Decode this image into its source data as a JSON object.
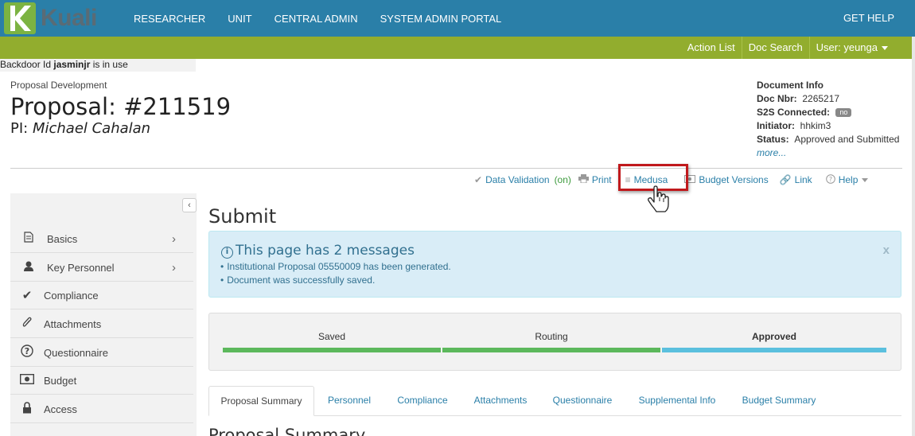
{
  "app": {
    "logo_text": "Kuali"
  },
  "topnav": [
    "RESEARCHER",
    "UNIT",
    "CENTRAL ADMIN",
    "SYSTEM ADMIN PORTAL"
  ],
  "get_help": "GET HELP",
  "greenbar": {
    "action_list": "Action List",
    "doc_search": "Doc Search",
    "user": "User: yeunga"
  },
  "backdoor": {
    "prefix": "Backdoor Id ",
    "user": "jasminjr",
    "suffix": " is in use"
  },
  "header": {
    "crumb": "Proposal Development",
    "title": "Proposal: #211519",
    "pi_label": "PI: ",
    "pi_name": "Michael Cahalan"
  },
  "docinfo": {
    "heading": "Document Info",
    "doc_nbr_label": "Doc Nbr:",
    "doc_nbr": "2265217",
    "s2s_label": "S2S Connected:",
    "s2s_value": "no",
    "initiator_label": "Initiator:",
    "initiator": "hhkim3",
    "status_label": "Status:",
    "status": "Approved and Submitted",
    "more": "more..."
  },
  "toolbar": {
    "data_validation": "Data Validation",
    "on": "(on)",
    "print": "Print",
    "medusa": "Medusa",
    "budget_versions": "Budget Versions",
    "link": "Link",
    "help": "Help"
  },
  "sidebar": {
    "items": [
      {
        "label": "Basics",
        "icon": "document-icon"
      },
      {
        "label": "Key Personnel",
        "icon": "person-icon"
      },
      {
        "label": "Compliance",
        "icon": "check-icon"
      },
      {
        "label": "Attachments",
        "icon": "paperclip-icon"
      },
      {
        "label": "Questionnaire",
        "icon": "question-icon"
      },
      {
        "label": "Budget",
        "icon": "money-icon"
      },
      {
        "label": "Access",
        "icon": "lock-icon"
      }
    ]
  },
  "main": {
    "heading": "Submit",
    "alert": {
      "title": "This page has 2 messages",
      "messages": [
        "Institutional Proposal 05550009 has been generated.",
        "Document was successfully saved."
      ],
      "close": "x"
    },
    "progress": [
      {
        "label": "Saved",
        "color": "#5cb85c"
      },
      {
        "label": "Routing",
        "color": "#5cb85c"
      },
      {
        "label": "Approved",
        "color": "#5bc0de"
      }
    ],
    "tabs": [
      "Proposal Summary",
      "Personnel",
      "Compliance",
      "Attachments",
      "Questionnaire",
      "Supplemental Info",
      "Budget Summary"
    ],
    "section_heading": "Proposal Summary"
  }
}
